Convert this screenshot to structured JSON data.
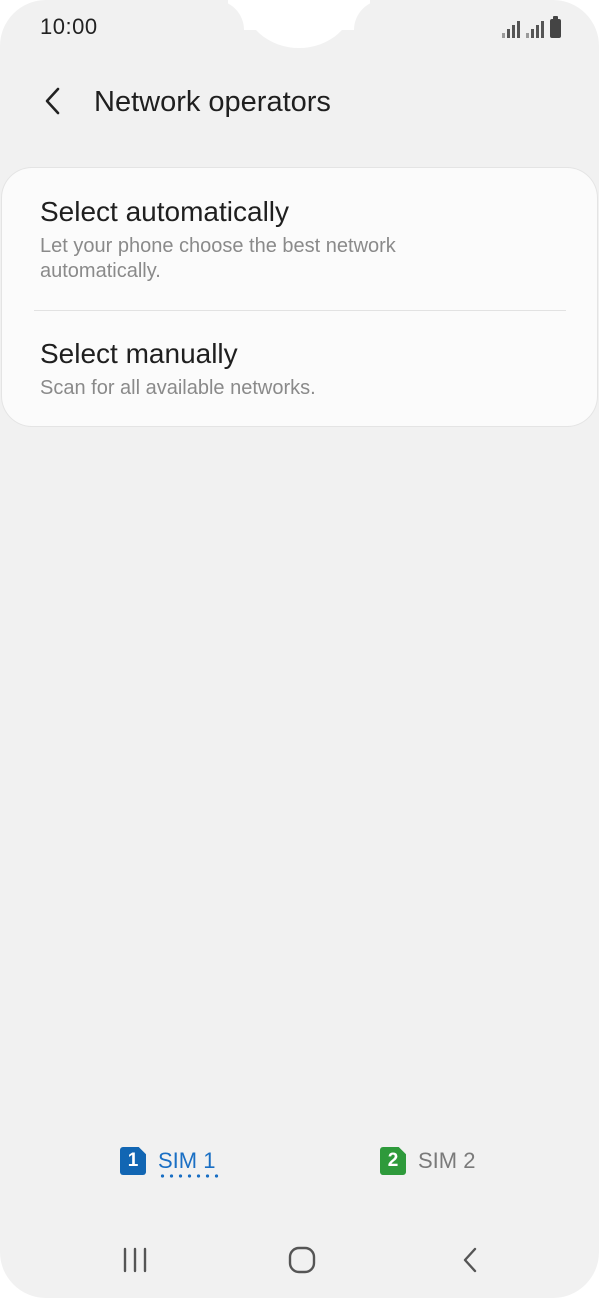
{
  "status_bar": {
    "time": "10:00",
    "icons": [
      "signal-icon-sim1",
      "signal-icon-sim2",
      "battery-icon"
    ]
  },
  "app_bar": {
    "back_icon": "chevron-left-icon",
    "title": "Network operators"
  },
  "options": [
    {
      "title": "Select automatically",
      "description": "Let your phone choose the best network automatically."
    },
    {
      "title": "Select manually",
      "description": "Scan for all available networks."
    }
  ],
  "sim_tabs": [
    {
      "badge": "1",
      "label": "SIM 1",
      "selected": true,
      "color": "#1266b3"
    },
    {
      "badge": "2",
      "label": "SIM 2",
      "selected": false,
      "color": "#2e9a3b"
    }
  ],
  "nav_bar": {
    "icons": [
      "recents-icon",
      "home-icon",
      "back-icon"
    ]
  },
  "colors": {
    "background": "#f1f1f1",
    "card": "#fbfbfb",
    "accent": "#1a6fc4"
  }
}
